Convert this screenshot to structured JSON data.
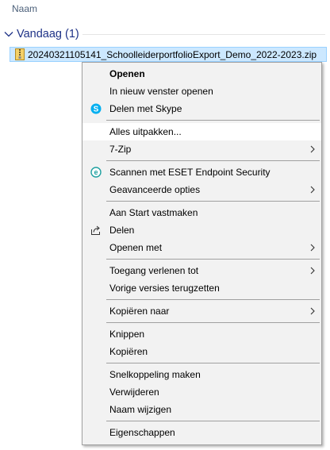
{
  "explorer": {
    "column_header": "Naam",
    "group_label": "Vandaag (1)",
    "selected_file": "20240321105141_SchoolleiderportfolioExport_Demo_2022-2023.zip"
  },
  "menu": {
    "items": [
      {
        "label": "Openen"
      },
      {
        "label": "In nieuw venster openen"
      },
      {
        "label": "Delen met Skype",
        "icon": "skype-icon"
      },
      {
        "label": "Alles uitpakken..."
      },
      {
        "label": "7-Zip",
        "submenu": true
      },
      {
        "label": "Scannen met ESET Endpoint Security",
        "icon": "eset-icon"
      },
      {
        "label": "Geavanceerde opties",
        "submenu": true
      },
      {
        "label": "Aan Start vastmaken"
      },
      {
        "label": "Delen",
        "icon": "share-icon"
      },
      {
        "label": "Openen met",
        "submenu": true
      },
      {
        "label": "Toegang verlenen tot",
        "submenu": true
      },
      {
        "label": "Vorige versies terugzetten"
      },
      {
        "label": "Kopiëren naar",
        "submenu": true
      },
      {
        "label": "Knippen"
      },
      {
        "label": "Kopiëren"
      },
      {
        "label": "Snelkoppeling maken"
      },
      {
        "label": "Verwijderen"
      },
      {
        "label": "Naam wijzigen"
      },
      {
        "label": "Eigenschappen"
      }
    ]
  },
  "colors": {
    "selection_fill": "#cce8ff",
    "selection_border": "#99d1ff",
    "group_text": "#1e3287",
    "menu_background": "#f2f2f2",
    "menu_hover": "#ffffff",
    "skype": "#00aff0",
    "eset": "#1ea0a0"
  }
}
